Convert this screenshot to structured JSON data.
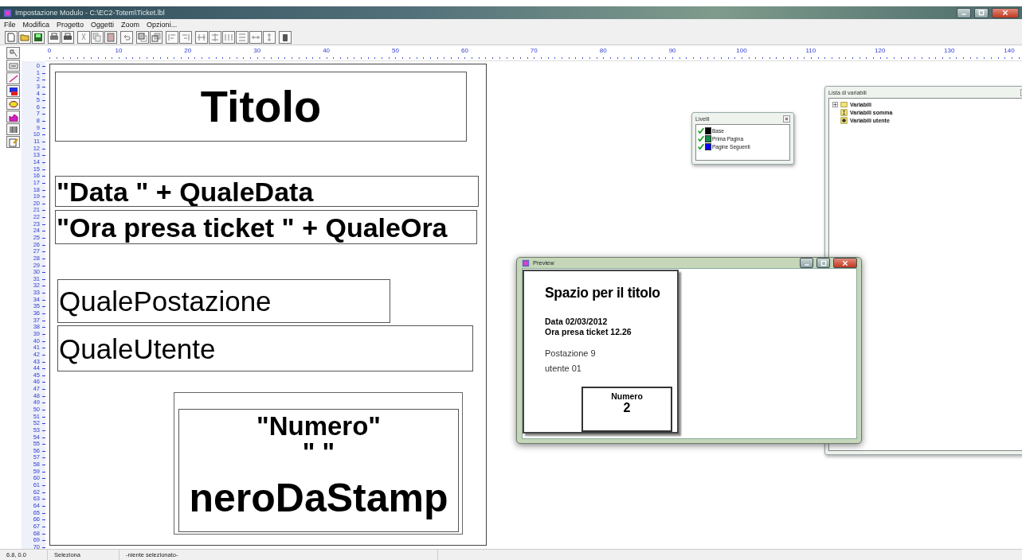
{
  "window": {
    "title": "Impostazione Modulo - C:\\EC2-Totem\\Ticket.lbl"
  },
  "menu": [
    "File",
    "Modifica",
    "Progetto",
    "Oggetti",
    "Zoom",
    "Opzioni..."
  ],
  "ruler": {
    "horizontal": [
      "0",
      "10",
      "20",
      "30",
      "40",
      "50",
      "60",
      "70",
      "80",
      "90",
      "100",
      "110",
      "120",
      "130",
      "140"
    ],
    "vertical": [
      "0",
      "1",
      "2",
      "3",
      "4",
      "5",
      "6",
      "7",
      "8",
      "9",
      "10",
      "11",
      "12",
      "13",
      "14",
      "15",
      "16",
      "17",
      "18",
      "19",
      "20",
      "21",
      "22",
      "23",
      "24",
      "25",
      "26",
      "27",
      "28",
      "29",
      "30",
      "31",
      "32",
      "33",
      "34",
      "35",
      "36",
      "37",
      "38",
      "39",
      "40",
      "41",
      "42",
      "43",
      "44",
      "45",
      "46",
      "47",
      "48",
      "49",
      "50",
      "51",
      "52",
      "53",
      "54",
      "55",
      "56",
      "57",
      "58",
      "59",
      "60",
      "61",
      "62",
      "63",
      "64",
      "65",
      "66",
      "67",
      "68",
      "69",
      "70"
    ]
  },
  "page": {
    "fields": [
      {
        "text": "Titolo",
        "kind": "title"
      },
      {
        "text": "\"Data \" + QualeData",
        "kind": "bold"
      },
      {
        "text": "\"Ora presa ticket \" + QualeOra",
        "kind": "bold"
      },
      {
        "text": "QualePostazione",
        "kind": "plain"
      },
      {
        "text": "QualeUtente",
        "kind": "plain"
      }
    ],
    "number_box": {
      "lines": [
        "\"Numero\"",
        "\" \"",
        "neroDaStamp"
      ]
    }
  },
  "layers_panel": {
    "title": "Livelli",
    "items": [
      {
        "label": "Base",
        "checked": true,
        "color": "#000000"
      },
      {
        "label": "Prima Pagina",
        "checked": true,
        "color": "#138a4a"
      },
      {
        "label": "Pagine Seguenti",
        "checked": true,
        "color": "#0000ff"
      }
    ]
  },
  "variables_panel": {
    "title": "Lista di variabili",
    "items": [
      {
        "label": "Variabili",
        "kind": "folder",
        "expandable": true
      },
      {
        "label": "Variabili somma",
        "kind": "sum",
        "expandable": false
      },
      {
        "label": "Variabili utente",
        "kind": "user",
        "expandable": false
      }
    ]
  },
  "preview": {
    "title": "Preview",
    "ticket": {
      "title": "Spazio per il titolo",
      "bold_lines": [
        "Data 02/03/2012",
        "Ora presa ticket 12.26"
      ],
      "lines": [
        "Postazione 9",
        "utente 01"
      ],
      "number_label": "Numero",
      "number": "2"
    }
  },
  "status_bar": [
    "6.8, 0.0",
    "Seleziona",
    "-niente selezionato-"
  ]
}
